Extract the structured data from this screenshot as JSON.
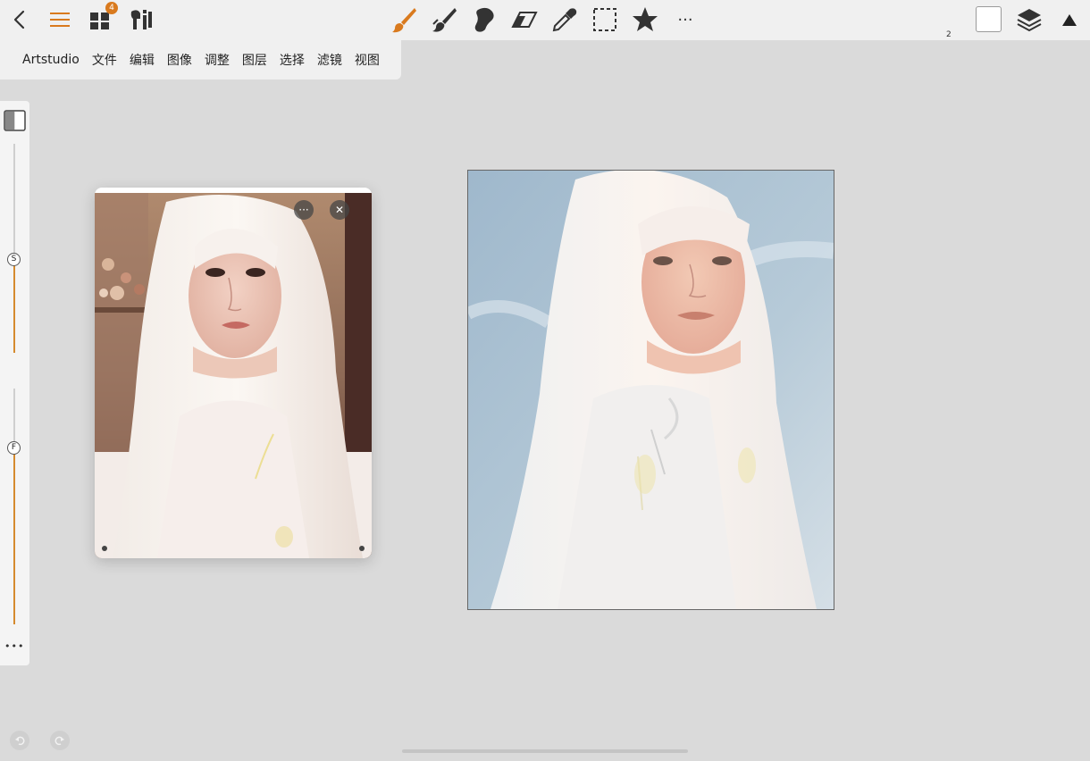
{
  "toolbar": {
    "back_icon": "chevron-left-icon",
    "menu_icon": "hamburger-menu-icon",
    "gallery_badge": "4",
    "accent_color": "#d97a1e",
    "tools": [
      "paintbrush-icon",
      "smudge-brush-icon",
      "blob-brush-icon",
      "eraser-icon",
      "eyedropper-icon",
      "selection-icon",
      "favorites-star-icon",
      "more-icon"
    ],
    "more_label": "···",
    "layer_count": "2"
  },
  "menubar": {
    "items": [
      "Artstudio",
      "文件",
      "编辑",
      "图像",
      "调整",
      "图层",
      "选择",
      "滤镜",
      "视图"
    ]
  },
  "left_toolbar": {
    "size_knob_label": "S",
    "flow_knob_label": "F",
    "size_value": 0.45,
    "flow_value": 0.75,
    "more_label": "•••"
  },
  "reference_panel": {
    "more_label": "···",
    "close_label": "✕"
  }
}
